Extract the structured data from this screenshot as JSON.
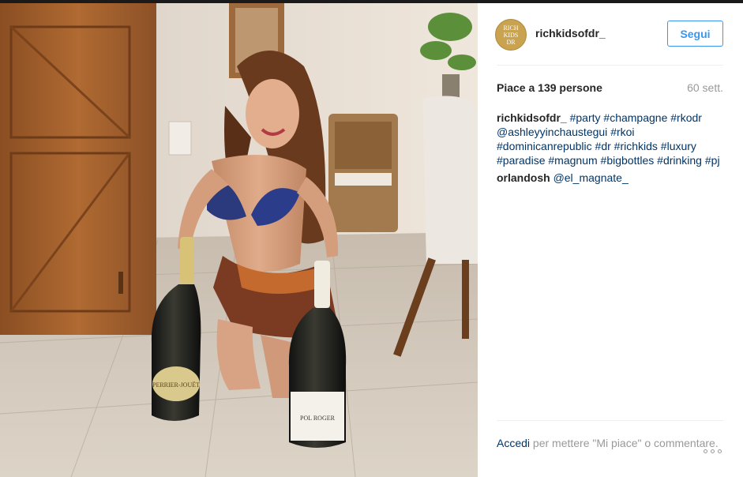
{
  "post": {
    "image_alt": "Woman kneeling on a tiled floor with two large champagne bottles",
    "bottle_left_label": "PERRIER-JOUËT",
    "bottle_right_label": "POL ROGER"
  },
  "header": {
    "avatar_lines": [
      "RICH",
      "KIDS",
      "DR"
    ],
    "username": "richkidsofdr_",
    "follow_label": "Segui"
  },
  "stats": {
    "likes": "Piace a 139 persone",
    "age": "60 sett."
  },
  "comments": [
    {
      "user": "richkidsofdr_",
      "parts": [
        "#party",
        "#champagne",
        "#rkodr",
        "@ashleyyinchaustegui",
        "#rkoi",
        "#dominicanrepublic",
        "#dr",
        "#richkids",
        "#luxury",
        "#paradise",
        "#magnum",
        "#bigbottles",
        "#drinking",
        "#pj"
      ]
    },
    {
      "user": "orlandosh",
      "parts": [
        "@el_magnate_"
      ]
    }
  ],
  "footer": {
    "login_link": "Accedi",
    "login_text": " per mettere \"Mi piace\" o commentare."
  },
  "icons": {
    "options": "more-options-icon"
  },
  "colors": {
    "link": "#003569",
    "follow": "#3897f0",
    "muted": "#999999"
  }
}
